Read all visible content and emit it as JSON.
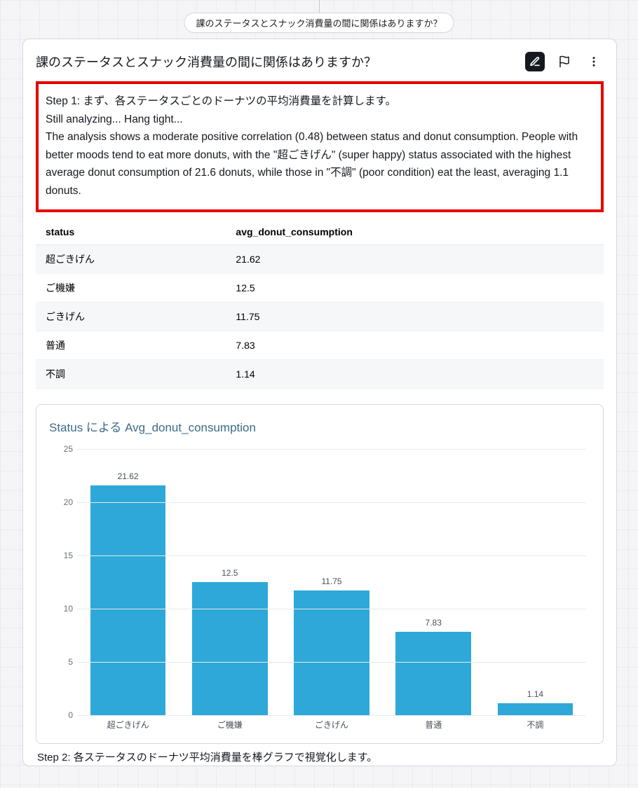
{
  "breadcrumb": "課のステータスとスナック消費量の間に関係はありますか？",
  "card": {
    "title": "課のステータスとスナック消費量の間に関係はありますか？"
  },
  "analysis": {
    "line1": "Step 1: まず、各ステータスごとのドーナツの平均消費量を計算します。",
    "line2": "Still analyzing... Hang tight...",
    "line3": "The analysis shows a moderate positive correlation (0.48) between status and donut consumption. People with better moods tend to eat more donuts, with the \"超ごきげん\" (super happy) status associated with the highest average donut consumption of 21.6 donuts, while those in \"不調\" (poor condition) eat the least, averaging 1.1 donuts."
  },
  "table": {
    "headers": {
      "col1": "status",
      "col2": "avg_donut_consumption"
    },
    "rows": [
      {
        "status": "超ごきげん",
        "value": "21.62"
      },
      {
        "status": "ご機嫌",
        "value": "12.5"
      },
      {
        "status": "ごきげん",
        "value": "11.75"
      },
      {
        "status": "普通",
        "value": "7.83"
      },
      {
        "status": "不調",
        "value": "1.14"
      }
    ]
  },
  "chart_data": {
    "type": "bar",
    "title": "Status による Avg_donut_consumption",
    "categories": [
      "超ごきげん",
      "ご機嫌",
      "ごきげん",
      "普通",
      "不調"
    ],
    "values": [
      21.62,
      12.5,
      11.75,
      7.83,
      1.14
    ],
    "xlabel": "",
    "ylabel": "",
    "ylim": [
      0,
      25
    ],
    "yticks": [
      0,
      5,
      10,
      15,
      20,
      25
    ]
  },
  "step2": "Step 2: 各ステータスのドーナツ平均消費量を棒グラフで視覚化します。"
}
